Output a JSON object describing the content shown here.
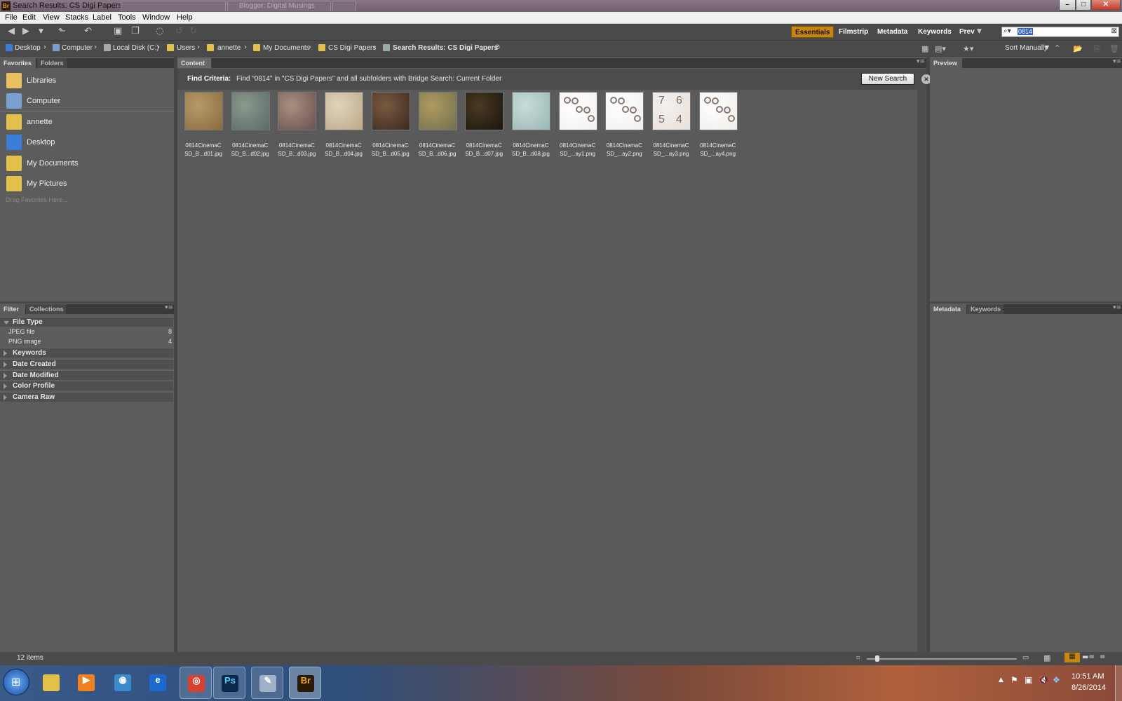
{
  "title_bar": {
    "app_badge": "Br",
    "title": "Search Results: CS Digi Papers",
    "ghost_tab_2": "Blogger: Digital Musings"
  },
  "menu": [
    "File",
    "Edit",
    "View",
    "Stacks",
    "Label",
    "Tools",
    "Window",
    "Help"
  ],
  "workspaces": [
    "Essentials",
    "Filmstrip",
    "Metadata",
    "Keywords",
    "Prev"
  ],
  "search": {
    "value": "0814"
  },
  "path": [
    "Desktop",
    "Computer",
    "Local Disk (C:)",
    "Users",
    "annette",
    "My Documents",
    "CS Digi Papers",
    "Search Results: CS Digi Papers"
  ],
  "sort_label": "Sort Manually",
  "left_tabs": [
    "Favorites",
    "Folders"
  ],
  "favorites": [
    {
      "label": "Libraries",
      "icon": "libraries-icon",
      "color": "#e8c060"
    },
    {
      "label": "Computer",
      "icon": "computer-icon",
      "color": "#7aa0d0"
    },
    {
      "label": "annette",
      "icon": "user-folder-icon",
      "color": "#e2c04a"
    },
    {
      "label": "Desktop",
      "icon": "desktop-icon",
      "color": "#3b7dd8"
    },
    {
      "label": "My Documents",
      "icon": "documents-icon",
      "color": "#e2c04a"
    },
    {
      "label": "My Pictures",
      "icon": "pictures-icon",
      "color": "#e2c04a"
    }
  ],
  "drag_hint": "Drag Favorites Here...",
  "filter_tabs": [
    "Filter",
    "Collections"
  ],
  "filter": {
    "open_section": "File Type",
    "rows": [
      {
        "label": "JPEG file",
        "count": "8"
      },
      {
        "label": "PNG image",
        "count": "4"
      }
    ],
    "sections": [
      "Keywords",
      "Date Created",
      "Date Modified",
      "Color Profile",
      "Camera Raw"
    ]
  },
  "content_tab": "Content",
  "find": {
    "label": "Find Criteria:",
    "text": "Find \"0814\" in \"CS Digi Papers\" and all subfolders with Bridge Search: Current Folder",
    "new_search": "New Search"
  },
  "thumbs": [
    {
      "l1": "0814CinemaC",
      "l2": "SD_B...d01.jpg",
      "c1": "#b89a68",
      "c2": "#8a6a40"
    },
    {
      "l1": "0814CinemaC",
      "l2": "SD_B...d02.jpg",
      "c1": "#8a9a8a",
      "c2": "#5a6a6a"
    },
    {
      "l1": "0814CinemaC",
      "l2": "SD_B...d03.jpg",
      "c1": "#a89080",
      "c2": "#6a5050"
    },
    {
      "l1": "0814CinemaC",
      "l2": "SD_B...d04.jpg",
      "c1": "#e0d4bc",
      "c2": "#bca888"
    },
    {
      "l1": "0814CinemaC",
      "l2": "SD_B...d05.jpg",
      "c1": "#7a5a40",
      "c2": "#3a2a20"
    },
    {
      "l1": "0814CinemaC",
      "l2": "SD_B...d06.jpg",
      "c1": "#b09a60",
      "c2": "#707050"
    },
    {
      "l1": "0814CinemaC",
      "l2": "SD_B...d07.jpg",
      "c1": "#4a3a20",
      "c2": "#1a1510"
    },
    {
      "l1": "0814CinemaC",
      "l2": "SD_B...d08.jpg",
      "c1": "#c8dcd8",
      "c2": "#98b8b4"
    },
    {
      "l1": "0814CinemaC",
      "l2": "SD_...ay1.png",
      "c1": "#ffffff",
      "c2": "#f4f0ee"
    },
    {
      "l1": "0814CinemaC",
      "l2": "SD_...ay2.png",
      "c1": "#ffffff",
      "c2": "#f0f0f0"
    },
    {
      "l1": "0814CinemaC",
      "l2": "SD_...ay3.png",
      "c1": "#f4f0ee",
      "c2": "#e8e0dc",
      "digits": [
        "7",
        "6",
        "5",
        "4"
      ]
    },
    {
      "l1": "0814CinemaC",
      "l2": "SD_...ay4.png",
      "c1": "#ffffff",
      "c2": "#f0ece8"
    }
  ],
  "right_tabs": {
    "preview": "Preview",
    "bottom": [
      "Metadata",
      "Keywords"
    ]
  },
  "status": {
    "items": "12 items"
  },
  "clock": {
    "time": "10:51 AM",
    "date": "8/26/2014"
  },
  "taskbar": [
    {
      "name": "explorer",
      "icon": "folder-icon",
      "bg": "#e2c04a",
      "glyph": ""
    },
    {
      "name": "media",
      "icon": "media-player-icon",
      "bg": "#f08020",
      "glyph": "▶"
    },
    {
      "name": "browser-alt",
      "icon": "network-icon",
      "bg": "#3a8acc",
      "glyph": "◉"
    },
    {
      "name": "ie",
      "icon": "internet-explorer-icon",
      "bg": "#1a6ad0",
      "glyph": "e"
    },
    {
      "name": "chrome",
      "icon": "chrome-icon",
      "bg": "#d84030",
      "glyph": "◎"
    },
    {
      "name": "photoshop",
      "icon": "photoshop-icon",
      "bg": "#0a2a4a",
      "glyph": "Ps"
    },
    {
      "name": "paint",
      "icon": "paint-icon",
      "bg": "#a0b0c8",
      "glyph": "✎"
    },
    {
      "name": "bridge",
      "icon": "bridge-icon",
      "bg": "#2b1a06",
      "glyph": "Br"
    }
  ],
  "colors": {
    "accent": "#c8860f",
    "panel": "#5c5c5c",
    "dark": "#3a3a3a"
  }
}
